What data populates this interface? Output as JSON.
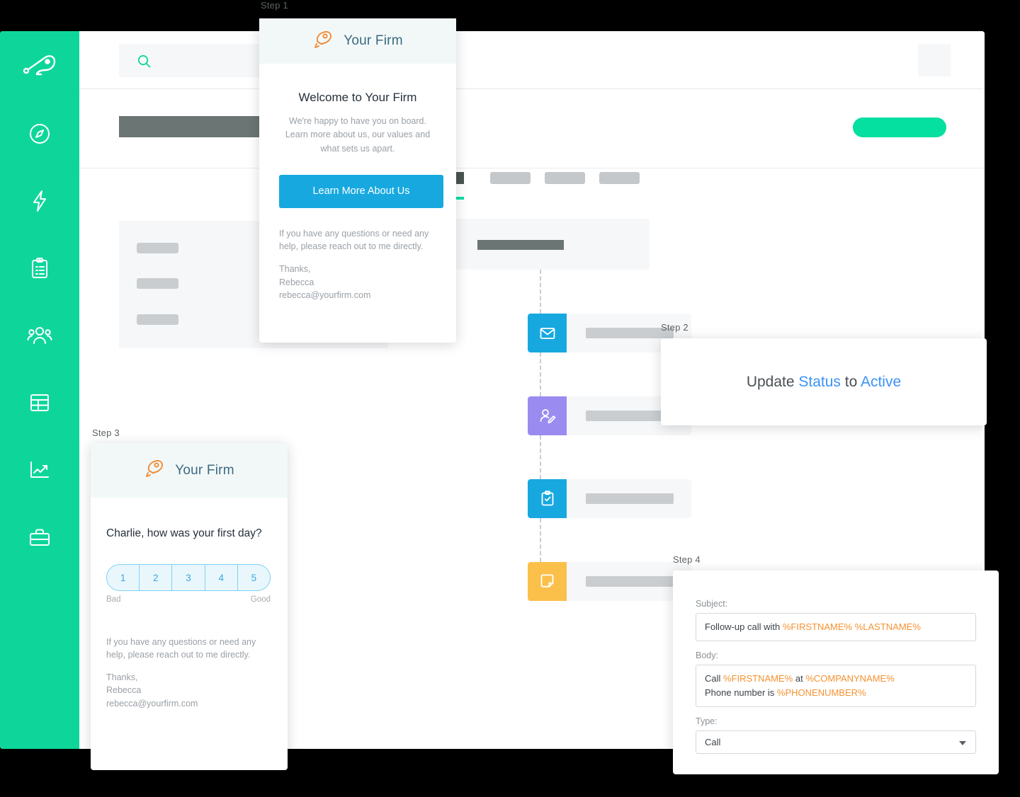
{
  "colors": {
    "sidebar_green": "#0ed69b",
    "cta_green": "#05dfa0",
    "primary_blue": "#17a8e0",
    "link_blue": "#3c93f7",
    "token_orange": "#f59231",
    "rating_blue": "#3aa8db",
    "icon_email_blue": "#17a8e0",
    "icon_person_purple": "#9a8bf0",
    "icon_task_blue": "#17a8e0",
    "icon_note_yellow": "#fbc04a"
  },
  "sidebar": {
    "items": [
      {
        "icon": "rocket-logo-icon",
        "label": "Home"
      },
      {
        "icon": "compass-icon",
        "label": "Explore"
      },
      {
        "icon": "lightning-icon",
        "label": "Automations"
      },
      {
        "icon": "clipboard-icon",
        "label": "Tasks"
      },
      {
        "icon": "people-icon",
        "label": "Contacts"
      },
      {
        "icon": "table-icon",
        "label": "Records"
      },
      {
        "icon": "chart-trend-icon",
        "label": "Reports"
      },
      {
        "icon": "toolbox-icon",
        "label": "Tools"
      }
    ]
  },
  "topbar": {
    "search_placeholder": "",
    "search_icon": "search-icon",
    "avatar": "avatar"
  },
  "workflow": {
    "steps": [
      {
        "icon": "email-icon",
        "color": "#17a8e0"
      },
      {
        "icon": "person-edit-icon",
        "color": "#9a8bf0"
      },
      {
        "icon": "clipboard-check-icon",
        "color": "#17a8e0"
      },
      {
        "icon": "note-icon",
        "color": "#fbc04a"
      }
    ]
  },
  "step1": {
    "label": "Step 1",
    "brand": "Your Firm",
    "logo_icon": "rocket-icon",
    "heading": "Welcome to Your Firm",
    "lead": "We're happy to have you on board. Learn more about us, our values and what sets us apart.",
    "button": "Learn More About Us",
    "help": "If you have any questions or need any help, please reach out to me directly.",
    "thanks": "Thanks,",
    "sender_name": "Rebecca",
    "sender_email": "rebecca@yourfirm.com"
  },
  "step2": {
    "label": "Step 2",
    "text_prefix": "Update ",
    "field": "Status",
    "text_middle": " to ",
    "value": "Active"
  },
  "step3": {
    "label": "Step 3",
    "brand": "Your Firm",
    "logo_icon": "rocket-icon",
    "question": "Charlie, how was your first day?",
    "rating_options": [
      "1",
      "2",
      "3",
      "4",
      "5"
    ],
    "legend_low": "Bad",
    "legend_high": "Good",
    "help": "If you have any questions or need any help, please reach out to me directly.",
    "thanks": "Thanks,",
    "sender_name": "Rebecca",
    "sender_email": "rebecca@yourfirm.com"
  },
  "step4": {
    "label": "Step 4",
    "subject_label": "Subject:",
    "subject_static": "Follow-up call with ",
    "subject_token_1": "%FIRSTNAME%",
    "subject_token_2": "%LASTNAME%",
    "body_label": "Body:",
    "body_line1_pre": "Call ",
    "body_line1_token1": "%FIRSTNAME%",
    "body_line1_mid": " at ",
    "body_line1_token2": "%COMPANYNAME%",
    "body_line2_pre": "Phone number is ",
    "body_line2_token1": "%PHONENUMBER%",
    "type_label": "Type:",
    "type_value": "Call",
    "caret_icon": "chevron-down-icon"
  }
}
